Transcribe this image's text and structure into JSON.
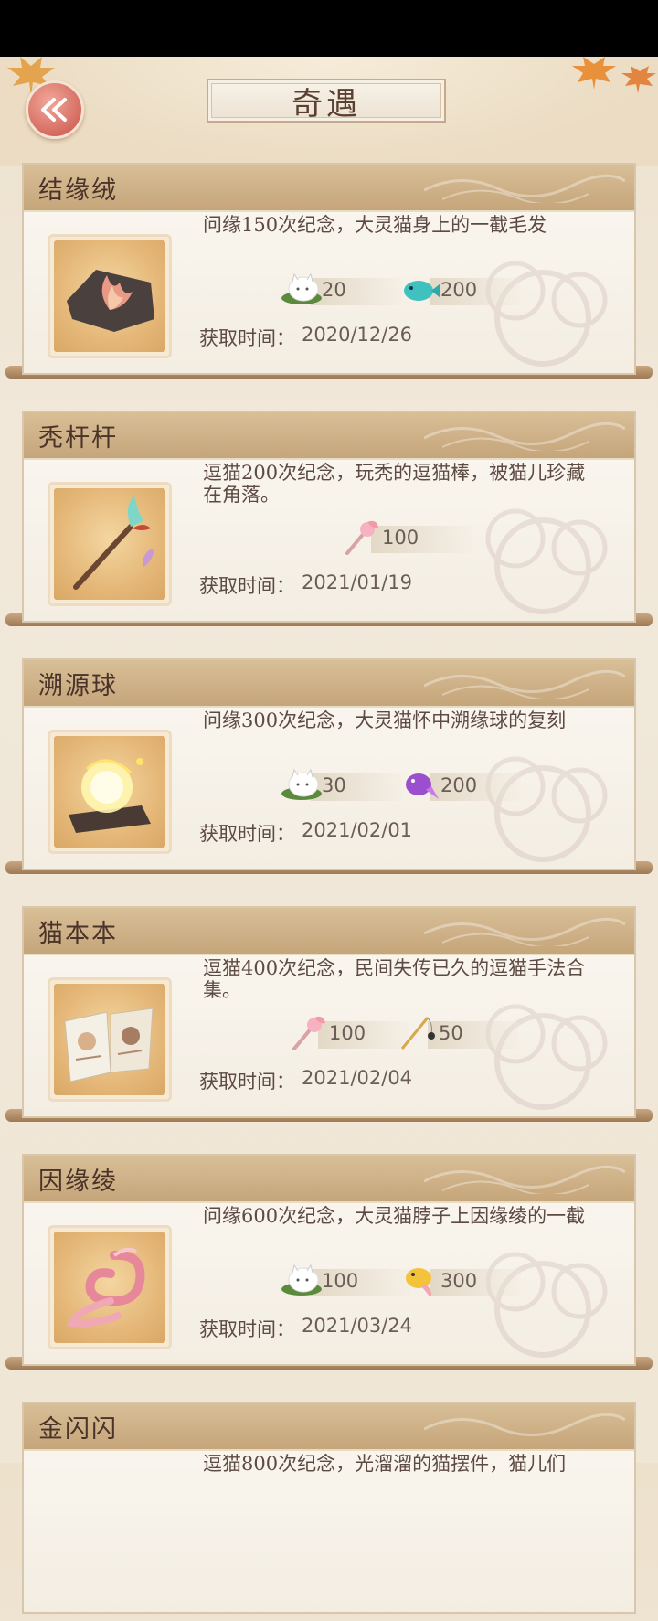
{
  "page": {
    "title": "奇遇"
  },
  "time_label": "获取时间：",
  "cards": [
    {
      "title": "结缘绒",
      "description": "问缘150次纪念，大灵猫身上的一截毛发",
      "item_icon": "fur-tuft-icon",
      "rewards": [
        {
          "icon": "cat-bun-icon",
          "amount": "20"
        },
        {
          "icon": "teal-fish-icon",
          "amount": "200"
        }
      ],
      "time": "2020/12/26"
    },
    {
      "title": "秃杆杆",
      "description": "逗猫200次纪念，玩秃的逗猫棒，被猫儿珍藏在角落。",
      "item_icon": "cat-teaser-wand-icon",
      "rewards": [
        {
          "icon": "pink-teaser-icon",
          "amount": "100"
        }
      ],
      "time": "2021/01/19"
    },
    {
      "title": "溯源球",
      "description": "问缘300次纪念，大灵猫怀中溯缘球的复刻",
      "item_icon": "glowing-orb-icon",
      "rewards": [
        {
          "icon": "cat-bun-icon",
          "amount": "30"
        },
        {
          "icon": "purple-fish-icon",
          "amount": "200"
        }
      ],
      "time": "2021/02/01"
    },
    {
      "title": "猫本本",
      "description": "逗猫400次纪念，民间失传已久的逗猫手法合集。",
      "item_icon": "open-book-icon",
      "rewards": [
        {
          "icon": "pink-teaser-icon",
          "amount": "100"
        },
        {
          "icon": "fishing-rod-icon",
          "amount": "50"
        }
      ],
      "time": "2021/02/04"
    },
    {
      "title": "因缘绫",
      "description": "问缘600次纪念，大灵猫脖子上因缘绫的一截",
      "item_icon": "ribbon-icon",
      "rewards": [
        {
          "icon": "cat-bun-icon",
          "amount": "100"
        },
        {
          "icon": "golden-fish-icon",
          "amount": "300"
        }
      ],
      "time": "2021/03/24"
    },
    {
      "title": "金闪闪",
      "description": "逗猫800次纪念，光溜溜的猫摆件，猫儿们"
    }
  ],
  "colors": {
    "header_band": "#c6a57a",
    "back_button": "#d56b60",
    "text_dark": "#4a3328"
  }
}
